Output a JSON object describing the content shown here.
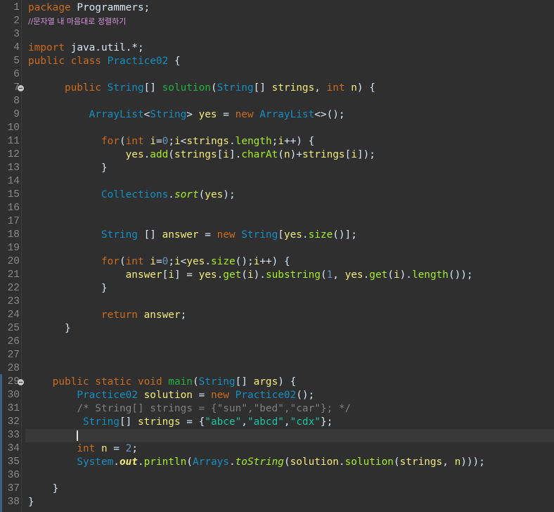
{
  "editor": {
    "line_numbers": [
      "1",
      "2",
      "3",
      "4",
      "5",
      "6",
      "7",
      "8",
      "9",
      "10",
      "11",
      "12",
      "13",
      "14",
      "15",
      "16",
      "17",
      "18",
      "19",
      "20",
      "21",
      "22",
      "23",
      "24",
      "25",
      "26",
      "27",
      "28",
      "29",
      "30",
      "31",
      "32",
      "33",
      "34",
      "35",
      "36",
      "37",
      "38"
    ],
    "lines": [
      [
        [
          "kw",
          "package "
        ],
        [
          "pl",
          "Programmers;"
        ]
      ],
      [
        [
          "cm-kr",
          "//문자열 내 마음대로 정렬하기"
        ]
      ],
      [],
      [
        [
          "kw",
          "import "
        ],
        [
          "pl",
          "java.util.*;"
        ]
      ],
      [
        [
          "kw",
          "public class "
        ],
        [
          "ty",
          "Practice02"
        ],
        [
          "pl",
          " {"
        ]
      ],
      [],
      [
        [
          "pl",
          "      "
        ],
        [
          "kw",
          "public "
        ],
        [
          "ty",
          "String"
        ],
        [
          "pl",
          "[] "
        ],
        [
          "fn",
          "solution"
        ],
        [
          "pl",
          "("
        ],
        [
          "ty",
          "String"
        ],
        [
          "pl",
          "[] "
        ],
        [
          "va",
          "strings"
        ],
        [
          "pl",
          ", "
        ],
        [
          "kw",
          "int "
        ],
        [
          "va",
          "n"
        ],
        [
          "pl",
          ") {"
        ]
      ],
      [],
      [
        [
          "pl",
          "          "
        ],
        [
          "ty",
          "ArrayList"
        ],
        [
          "pl",
          "<"
        ],
        [
          "ty",
          "String"
        ],
        [
          "pl",
          "> "
        ],
        [
          "va",
          "yes"
        ],
        [
          "pl",
          " = "
        ],
        [
          "kw",
          "new "
        ],
        [
          "ty",
          "ArrayList"
        ],
        [
          "pl",
          "<>();"
        ]
      ],
      [],
      [
        [
          "pl",
          "            "
        ],
        [
          "kw",
          "for"
        ],
        [
          "pl",
          "("
        ],
        [
          "kw",
          "int "
        ],
        [
          "va",
          "i"
        ],
        [
          "pl",
          "="
        ],
        [
          "nu",
          "0"
        ],
        [
          "pl",
          ";"
        ],
        [
          "va",
          "i"
        ],
        [
          "pl",
          "<"
        ],
        [
          "va",
          "strings"
        ],
        [
          "pl",
          "."
        ],
        [
          "me",
          "length"
        ],
        [
          "pl",
          ";"
        ],
        [
          "va",
          "i"
        ],
        [
          "pl",
          "++) {"
        ]
      ],
      [
        [
          "pl",
          "                "
        ],
        [
          "va",
          "yes"
        ],
        [
          "pl",
          "."
        ],
        [
          "me",
          "add"
        ],
        [
          "pl",
          "("
        ],
        [
          "va",
          "strings"
        ],
        [
          "pl",
          "["
        ],
        [
          "va",
          "i"
        ],
        [
          "pl",
          "]."
        ],
        [
          "me",
          "charAt"
        ],
        [
          "pl",
          "("
        ],
        [
          "va",
          "n"
        ],
        [
          "pl",
          ")+"
        ],
        [
          "va",
          "strings"
        ],
        [
          "pl",
          "["
        ],
        [
          "va",
          "i"
        ],
        [
          "pl",
          "]);"
        ]
      ],
      [
        [
          "pl",
          "            }"
        ]
      ],
      [],
      [
        [
          "pl",
          "            "
        ],
        [
          "ty",
          "Collections"
        ],
        [
          "pl",
          "."
        ],
        [
          "me it",
          "sort"
        ],
        [
          "pl",
          "("
        ],
        [
          "va",
          "yes"
        ],
        [
          "pl",
          ");"
        ]
      ],
      [],
      [],
      [
        [
          "pl",
          "            "
        ],
        [
          "ty",
          "String"
        ],
        [
          "pl",
          " [] "
        ],
        [
          "va",
          "answer"
        ],
        [
          "pl",
          " = "
        ],
        [
          "kw",
          "new "
        ],
        [
          "ty",
          "String"
        ],
        [
          "pl",
          "["
        ],
        [
          "va",
          "yes"
        ],
        [
          "pl",
          "."
        ],
        [
          "me",
          "size"
        ],
        [
          "pl",
          "()];"
        ]
      ],
      [],
      [
        [
          "pl",
          "            "
        ],
        [
          "kw",
          "for"
        ],
        [
          "pl",
          "("
        ],
        [
          "kw",
          "int "
        ],
        [
          "va",
          "i"
        ],
        [
          "pl",
          "="
        ],
        [
          "nu",
          "0"
        ],
        [
          "pl",
          ";"
        ],
        [
          "va",
          "i"
        ],
        [
          "pl",
          "<"
        ],
        [
          "va",
          "yes"
        ],
        [
          "pl",
          "."
        ],
        [
          "me",
          "size"
        ],
        [
          "pl",
          "();"
        ],
        [
          "va",
          "i"
        ],
        [
          "pl",
          "++) {"
        ]
      ],
      [
        [
          "pl",
          "                "
        ],
        [
          "va",
          "answer"
        ],
        [
          "pl",
          "["
        ],
        [
          "va",
          "i"
        ],
        [
          "pl",
          "] = "
        ],
        [
          "va",
          "yes"
        ],
        [
          "pl",
          "."
        ],
        [
          "me",
          "get"
        ],
        [
          "pl",
          "("
        ],
        [
          "va",
          "i"
        ],
        [
          "pl",
          ")."
        ],
        [
          "me",
          "substring"
        ],
        [
          "pl",
          "("
        ],
        [
          "nu",
          "1"
        ],
        [
          "pl",
          ", "
        ],
        [
          "va",
          "yes"
        ],
        [
          "pl",
          "."
        ],
        [
          "me",
          "get"
        ],
        [
          "pl",
          "("
        ],
        [
          "va",
          "i"
        ],
        [
          "pl",
          ")."
        ],
        [
          "me",
          "length"
        ],
        [
          "pl",
          "());"
        ]
      ],
      [
        [
          "pl",
          "            }"
        ]
      ],
      [],
      [
        [
          "pl",
          "            "
        ],
        [
          "kw",
          "return "
        ],
        [
          "va",
          "answer"
        ],
        [
          "pl",
          ";"
        ]
      ],
      [
        [
          "pl",
          "      }"
        ]
      ],
      [],
      [],
      [],
      [
        [
          "pl",
          "    "
        ],
        [
          "kw",
          "public static void "
        ],
        [
          "fn",
          "main"
        ],
        [
          "pl",
          "("
        ],
        [
          "ty",
          "String"
        ],
        [
          "pl",
          "[] "
        ],
        [
          "va",
          "args"
        ],
        [
          "pl",
          ") {"
        ]
      ],
      [
        [
          "pl",
          "        "
        ],
        [
          "ty",
          "Practice02"
        ],
        [
          "pl",
          " "
        ],
        [
          "va",
          "solution"
        ],
        [
          "pl",
          " = "
        ],
        [
          "kw",
          "new "
        ],
        [
          "ty",
          "Practice02"
        ],
        [
          "pl",
          "();"
        ]
      ],
      [
        [
          "pl",
          "        "
        ],
        [
          "cm",
          "/* String[] strings = {\"sun\",\"bed\",\"car\"}; */"
        ]
      ],
      [
        [
          "pl",
          "         "
        ],
        [
          "ty",
          "String"
        ],
        [
          "pl",
          "[] "
        ],
        [
          "va",
          "strings"
        ],
        [
          "pl",
          " = {"
        ],
        [
          "st",
          "\"abce\""
        ],
        [
          "pl",
          ","
        ],
        [
          "st",
          "\"abcd\""
        ],
        [
          "pl",
          ","
        ],
        [
          "st",
          "\"cdx\""
        ],
        [
          "pl",
          "};"
        ]
      ],
      [],
      [
        [
          "pl",
          "        "
        ],
        [
          "kw",
          "int "
        ],
        [
          "va",
          "n"
        ],
        [
          "pl",
          " = "
        ],
        [
          "nu",
          "2"
        ],
        [
          "pl",
          ";"
        ]
      ],
      [
        [
          "pl",
          "        "
        ],
        [
          "ty",
          "System"
        ],
        [
          "pl",
          "."
        ],
        [
          "va it bo",
          "out"
        ],
        [
          "pl",
          "."
        ],
        [
          "me",
          "println"
        ],
        [
          "pl",
          "("
        ],
        [
          "ty",
          "Arrays"
        ],
        [
          "pl",
          "."
        ],
        [
          "me it",
          "toString"
        ],
        [
          "pl",
          "("
        ],
        [
          "va",
          "solution"
        ],
        [
          "pl",
          "."
        ],
        [
          "me",
          "solution"
        ],
        [
          "pl",
          "("
        ],
        [
          "va",
          "strings"
        ],
        [
          "pl",
          ", "
        ],
        [
          "va",
          "n"
        ],
        [
          "pl",
          ")));"
        ]
      ],
      [],
      [
        [
          "pl",
          "    }"
        ]
      ],
      [
        [
          "pl",
          "}"
        ]
      ]
    ],
    "fold_markers": [
      7,
      29
    ],
    "current_line": 33,
    "marked_range": [
      29,
      38
    ],
    "colors": {
      "background": "#2f2f2f",
      "keyword": "#cc6c1d",
      "type": "#1290c3",
      "method_decl": "#1eb540",
      "variable": "#f3ec79",
      "number": "#6897bb",
      "string": "#17c6a3",
      "comment": "#808080",
      "korean_comment": "#d197d9",
      "method_call": "#a7ec21"
    }
  }
}
